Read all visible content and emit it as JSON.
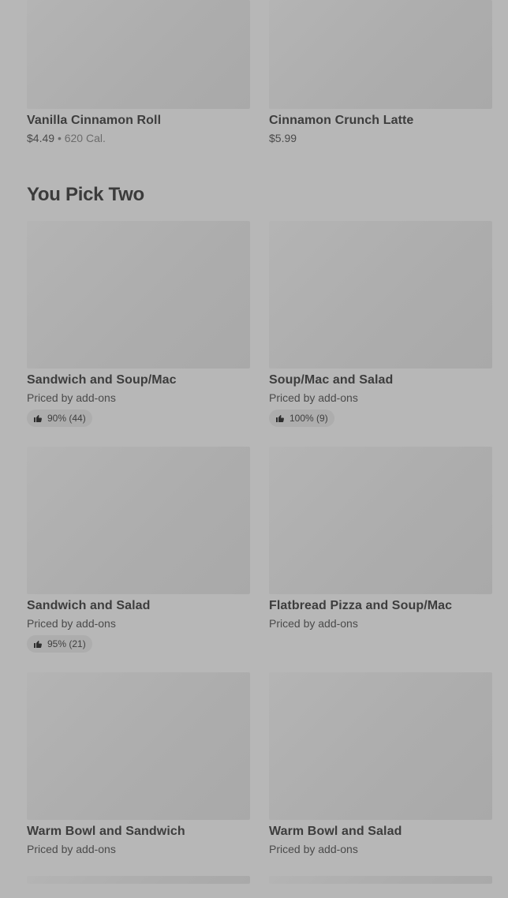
{
  "top_items": [
    {
      "name": "Vanilla Cinnamon Roll",
      "price": "$4.49",
      "separator": "•",
      "calories": "620 Cal."
    },
    {
      "name": "Cinnamon Crunch Latte",
      "price": "$5.99"
    }
  ],
  "section": {
    "title": "You Pick Two"
  },
  "pick_items": [
    {
      "name": "Sandwich and Soup/Mac",
      "price": "Priced by add-ons",
      "rating": "90% (44)"
    },
    {
      "name": "Soup/Mac and Salad",
      "price": "Priced by add-ons",
      "rating": "100% (9)"
    },
    {
      "name": "Sandwich and Salad",
      "price": "Priced by add-ons",
      "rating": "95% (21)"
    },
    {
      "name": "Flatbread Pizza and Soup/Mac",
      "price": "Priced by add-ons"
    },
    {
      "name": "Warm Bowl and Sandwich",
      "price": "Priced by add-ons"
    },
    {
      "name": "Warm Bowl and Salad",
      "price": "Priced by add-ons"
    }
  ],
  "icons": {
    "rating": "thumbs-up-icon"
  },
  "colors": {
    "overlay_background": "#b7b7b7",
    "image_placeholder": "#adadad",
    "text_primary": "#3d3d3d"
  }
}
